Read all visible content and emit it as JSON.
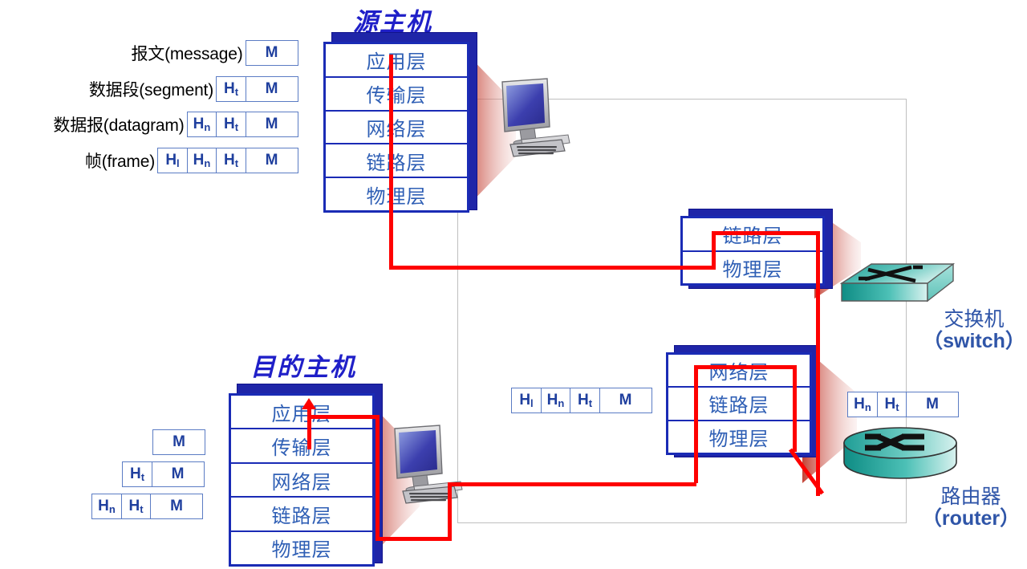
{
  "diagram": {
    "title": "TCP/IP Protocol Stack Data Encapsulation Across Hosts, Switch and Router",
    "colors": {
      "stack_border": "#1a2bb5",
      "layer_text": "#2f5fb5",
      "host_title": "#1f1fc8",
      "pdu_border": "#5b7cc4",
      "pdu_text": "#1f3f9e",
      "path_red": "#fe0000",
      "device_teal": "#3fb8ac",
      "caption_blue": "#2f55a8",
      "boundary_gray": "#bfbfbf"
    }
  },
  "encapsulation_legend": [
    {
      "label": "报文(message)",
      "cells": [
        {
          "text": "M",
          "sub": "",
          "type": "m"
        }
      ]
    },
    {
      "label": "数据段(segment)",
      "cells": [
        {
          "text": "H",
          "sub": "t",
          "type": "h"
        },
        {
          "text": "M",
          "sub": "",
          "type": "m"
        }
      ]
    },
    {
      "label": "数据报(datagram)",
      "cells": [
        {
          "text": "H",
          "sub": "n",
          "type": "h"
        },
        {
          "text": "H",
          "sub": "t",
          "type": "h"
        },
        {
          "text": "M",
          "sub": "",
          "type": "m"
        }
      ]
    },
    {
      "label": "帧(frame)",
      "cells": [
        {
          "text": "H",
          "sub": "l",
          "type": "h"
        },
        {
          "text": "H",
          "sub": "n",
          "type": "h"
        },
        {
          "text": "H",
          "sub": "t",
          "type": "h"
        },
        {
          "text": "M",
          "sub": "",
          "type": "m"
        }
      ]
    }
  ],
  "source_host": {
    "title": "源主机",
    "layers": [
      "应用层",
      "传输层",
      "网络层",
      "链路层",
      "物理层"
    ]
  },
  "destination_host": {
    "title": "目的主机",
    "layers": [
      "应用层",
      "传输层",
      "网络层",
      "链路层",
      "物理层"
    ]
  },
  "switch_node": {
    "layers": [
      "链路层",
      "物理层"
    ],
    "caption_cn": "交换机",
    "caption_en": "（switch）",
    "icon": "switch-icon"
  },
  "router_node": {
    "layers": [
      "网络层",
      "链路层",
      "物理层"
    ],
    "caption_cn": "路由器",
    "caption_en": "（router）",
    "icon": "router-icon"
  },
  "decapsulation_boxes": [
    {
      "cells": [
        {
          "text": "M",
          "sub": "",
          "type": "m"
        }
      ]
    },
    {
      "cells": [
        {
          "text": "H",
          "sub": "t",
          "type": "h"
        },
        {
          "text": "M",
          "sub": "",
          "type": "m"
        }
      ]
    },
    {
      "cells": [
        {
          "text": "H",
          "sub": "n",
          "type": "h"
        },
        {
          "text": "H",
          "sub": "t",
          "type": "h"
        },
        {
          "text": "M",
          "sub": "",
          "type": "m"
        }
      ]
    }
  ],
  "link_frame_box": {
    "cells": [
      {
        "text": "H",
        "sub": "l",
        "type": "h"
      },
      {
        "text": "H",
        "sub": "n",
        "type": "h"
      },
      {
        "text": "H",
        "sub": "t",
        "type": "h"
      },
      {
        "text": "M",
        "sub": "",
        "type": "m"
      }
    ]
  },
  "router_datagram_box": {
    "cells": [
      {
        "text": "H",
        "sub": "n",
        "type": "h"
      },
      {
        "text": "H",
        "sub": "t",
        "type": "h"
      },
      {
        "text": "M",
        "sub": "",
        "type": "m"
      }
    ]
  }
}
